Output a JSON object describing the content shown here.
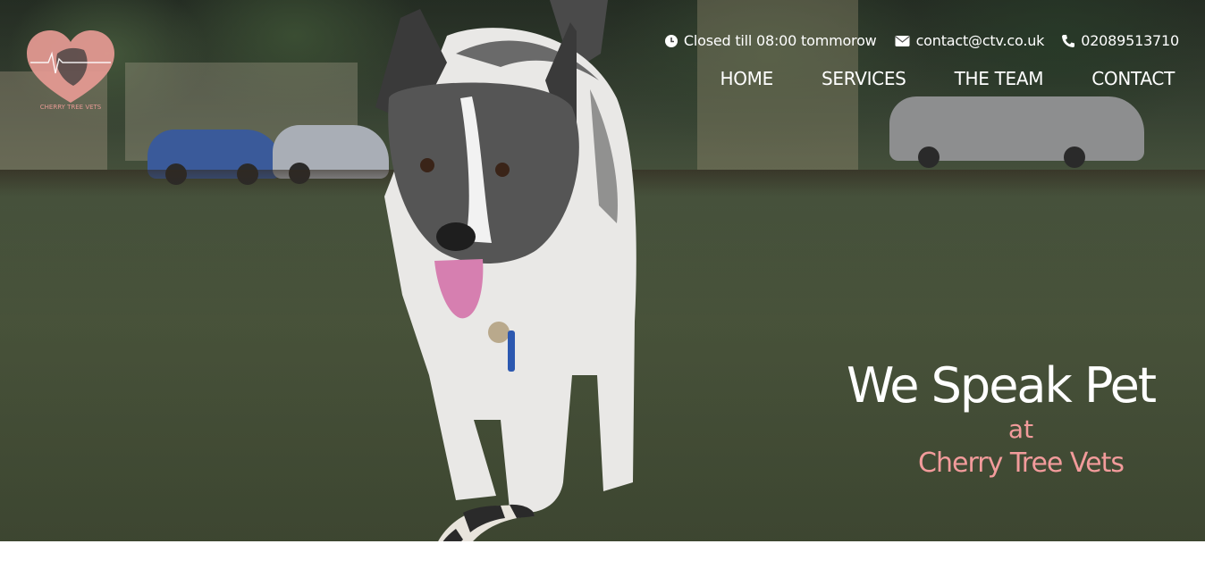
{
  "header": {
    "logo_alt": "Cherry Tree Vets logo",
    "logo_text": "CHERRY TREE VETS",
    "hours": "Closed till 08:00 tommorow",
    "email": "contact@ctv.co.uk",
    "phone": "02089513710"
  },
  "nav": {
    "items": [
      {
        "label": "HOME"
      },
      {
        "label": "SERVICES"
      },
      {
        "label": "THE TEAM"
      },
      {
        "label": "CONTACT"
      }
    ]
  },
  "hero": {
    "headline": "We Speak Pet",
    "connector": "at",
    "brand": "Cherry Tree Vets"
  },
  "colors": {
    "accent": "#f29b9b",
    "logo": "#e69a94",
    "text": "#ffffff"
  },
  "icons": {
    "hours": "clock-icon",
    "email": "envelope-icon",
    "phone": "phone-icon"
  }
}
